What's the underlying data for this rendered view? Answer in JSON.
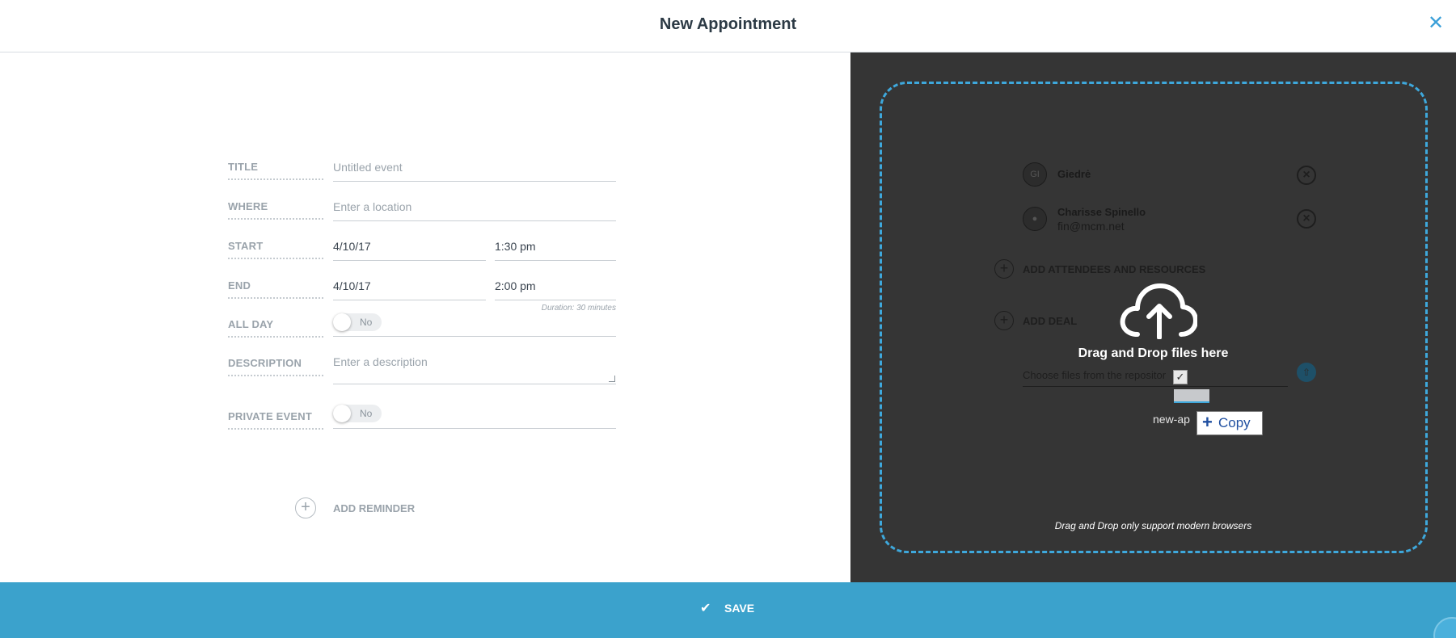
{
  "header": {
    "title": "New Appointment",
    "close_icon": "close-icon"
  },
  "form": {
    "title": {
      "label": "TITLE",
      "placeholder": "Untitled event"
    },
    "where": {
      "label": "WHERE",
      "placeholder": "Enter a location"
    },
    "start": {
      "label": "START",
      "date": "4/10/17",
      "time": "1:30 pm"
    },
    "end": {
      "label": "END",
      "date": "4/10/17",
      "time": "2:00 pm",
      "duration": "Duration: 30 minutes"
    },
    "all_day": {
      "label": "ALL DAY",
      "value": "No"
    },
    "description": {
      "label": "DESCRIPTION",
      "placeholder": "Enter a description"
    },
    "private_event": {
      "label": "PRIVATE EVENT",
      "value": "No"
    },
    "add_reminder": "ADD REMINDER"
  },
  "drop_zone": {
    "title": "Drag and Drop files here",
    "note": "Drag and Drop only support modern browsers",
    "attendees": [
      {
        "initials": "GI",
        "name": "Giedrė",
        "email": ""
      },
      {
        "initials": "",
        "name": "Charisse Spinello",
        "email": "fin@mcm.net"
      }
    ],
    "add_attendees": "ADD ATTENDEES AND RESOURCES",
    "add_deal": "ADD DEAL",
    "files_placeholder": "Choose files from the repositor",
    "drag_file_name": "new-ap",
    "copy_label": "Copy"
  },
  "footer": {
    "save_label": "SAVE"
  },
  "colors": {
    "accent": "#3ba2cc",
    "dashed": "#3ea8dc",
    "panel": "#353535"
  }
}
